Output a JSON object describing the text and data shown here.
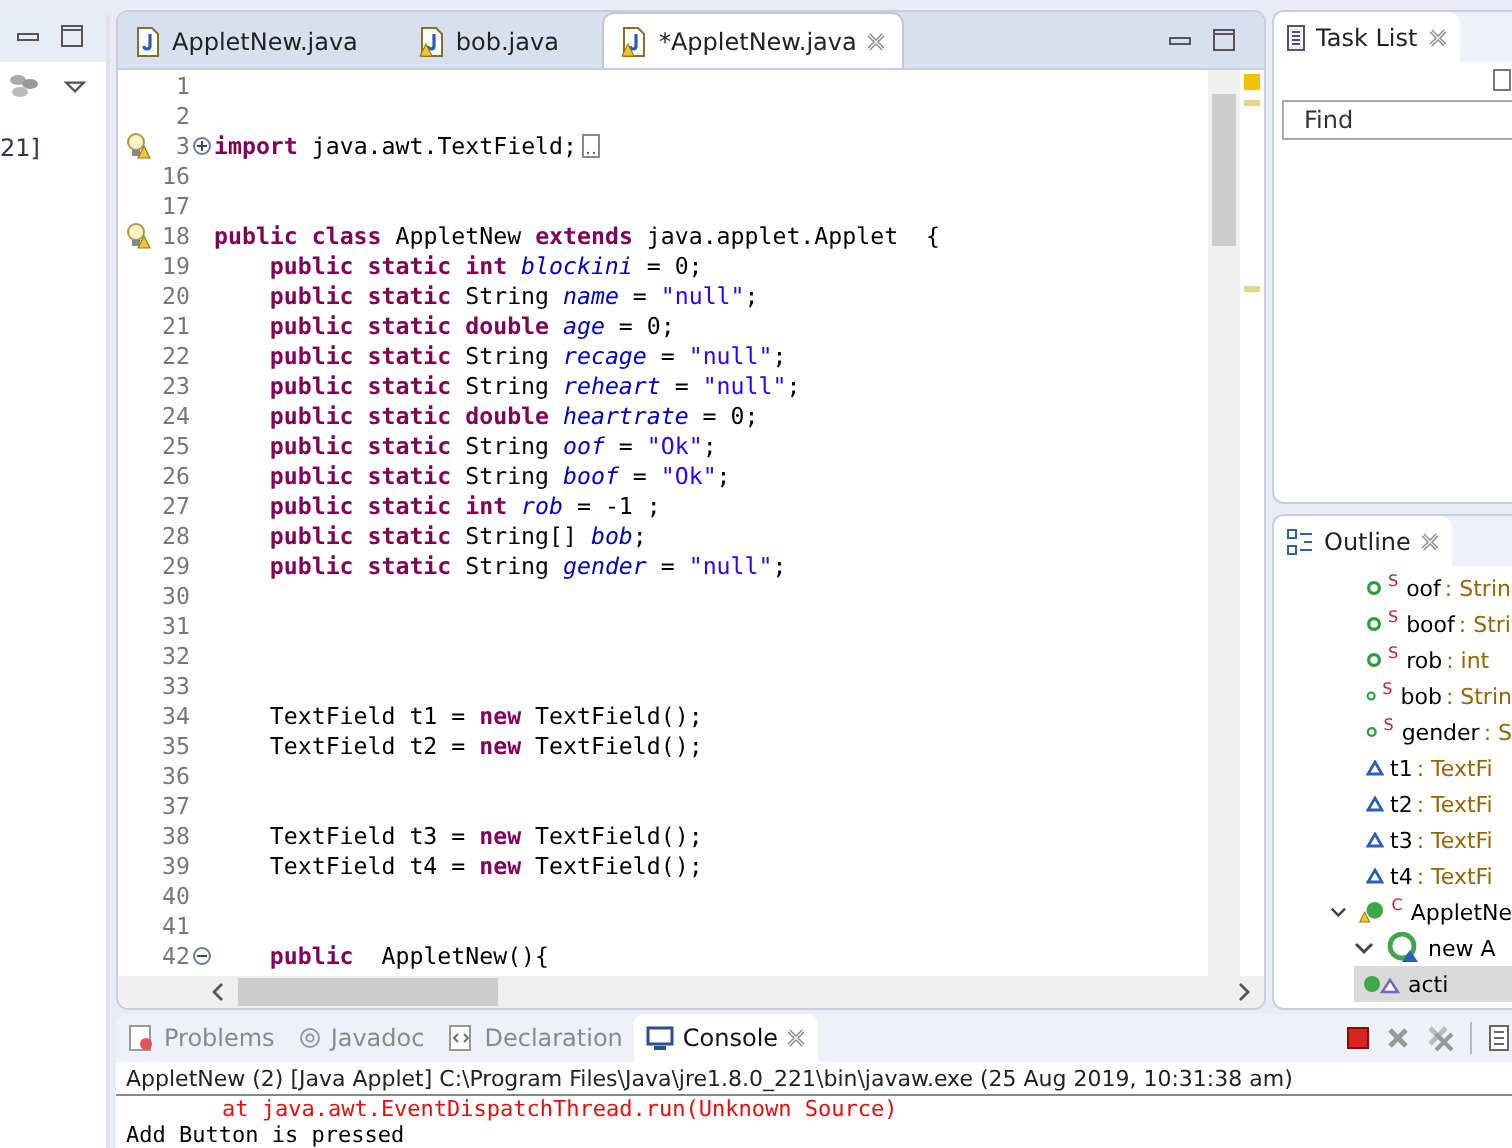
{
  "left_pane": {
    "fragment": "21]"
  },
  "editor": {
    "tabs": [
      {
        "label": "AppletNew.java",
        "selected": false,
        "warning": false,
        "closable": false
      },
      {
        "label": "bob.java",
        "selected": false,
        "warning": true,
        "closable": false
      },
      {
        "label": "*AppletNew.java",
        "selected": true,
        "warning": true,
        "closable": true
      }
    ],
    "lines": [
      {
        "number": "1"
      },
      {
        "number": "2"
      },
      {
        "number": "3",
        "warning": true,
        "collapsed": true,
        "segments": [
          {
            "kind": "kw",
            "text": "import "
          },
          {
            "kind": "plain",
            "text": "java.awt.TextField;"
          }
        ]
      },
      {
        "number": "16"
      },
      {
        "number": "17"
      },
      {
        "number": "18",
        "warning": true,
        "segments": [
          {
            "kind": "kw",
            "text": "public class "
          },
          {
            "kind": "plain",
            "text": "AppletNew "
          },
          {
            "kind": "kw",
            "text": "extends "
          },
          {
            "kind": "plain",
            "text": "java.applet.Applet  {"
          }
        ]
      },
      {
        "number": "19",
        "indent": true,
        "segments": [
          {
            "kind": "kw",
            "text": "public static int "
          },
          {
            "kind": "field",
            "text": "blockini"
          },
          {
            "kind": "plain",
            "text": " = 0;"
          }
        ]
      },
      {
        "number": "20",
        "indent": true,
        "segments": [
          {
            "kind": "kw",
            "text": "public static"
          },
          {
            "kind": "plain",
            "text": " String "
          },
          {
            "kind": "field",
            "text": "name"
          },
          {
            "kind": "plain",
            "text": " = "
          },
          {
            "kind": "str",
            "text": "\"null\""
          },
          {
            "kind": "plain",
            "text": ";"
          }
        ]
      },
      {
        "number": "21",
        "indent": true,
        "segments": [
          {
            "kind": "kw",
            "text": "public static double "
          },
          {
            "kind": "field",
            "text": "age"
          },
          {
            "kind": "plain",
            "text": " = 0;"
          }
        ]
      },
      {
        "number": "22",
        "indent": true,
        "segments": [
          {
            "kind": "kw",
            "text": "public static"
          },
          {
            "kind": "plain",
            "text": " String "
          },
          {
            "kind": "field",
            "text": "recage"
          },
          {
            "kind": "plain",
            "text": " = "
          },
          {
            "kind": "str",
            "text": "\"null\""
          },
          {
            "kind": "plain",
            "text": ";"
          }
        ]
      },
      {
        "number": "23",
        "indent": true,
        "segments": [
          {
            "kind": "kw",
            "text": "public static"
          },
          {
            "kind": "plain",
            "text": " String "
          },
          {
            "kind": "field",
            "text": "reheart"
          },
          {
            "kind": "plain",
            "text": " = "
          },
          {
            "kind": "str",
            "text": "\"null\""
          },
          {
            "kind": "plain",
            "text": ";"
          }
        ]
      },
      {
        "number": "24",
        "indent": true,
        "segments": [
          {
            "kind": "kw",
            "text": "public static double "
          },
          {
            "kind": "field",
            "text": "heartrate"
          },
          {
            "kind": "plain",
            "text": " = 0;"
          }
        ]
      },
      {
        "number": "25",
        "indent": true,
        "segments": [
          {
            "kind": "kw",
            "text": "public static"
          },
          {
            "kind": "plain",
            "text": " String "
          },
          {
            "kind": "field",
            "text": "oof"
          },
          {
            "kind": "plain",
            "text": " = "
          },
          {
            "kind": "str",
            "text": "\"Ok\""
          },
          {
            "kind": "plain",
            "text": ";"
          }
        ]
      },
      {
        "number": "26",
        "indent": true,
        "segments": [
          {
            "kind": "kw",
            "text": "public static"
          },
          {
            "kind": "plain",
            "text": " String "
          },
          {
            "kind": "field",
            "text": "boof"
          },
          {
            "kind": "plain",
            "text": " = "
          },
          {
            "kind": "str",
            "text": "\"Ok\""
          },
          {
            "kind": "plain",
            "text": ";"
          }
        ]
      },
      {
        "number": "27",
        "indent": true,
        "segments": [
          {
            "kind": "kw",
            "text": "public static int "
          },
          {
            "kind": "field",
            "text": "rob"
          },
          {
            "kind": "plain",
            "text": " = -1 ;"
          }
        ]
      },
      {
        "number": "28",
        "indent": true,
        "segments": [
          {
            "kind": "kw",
            "text": "public static"
          },
          {
            "kind": "plain",
            "text": " String[] "
          },
          {
            "kind": "field",
            "text": "bob"
          },
          {
            "kind": "plain",
            "text": ";"
          }
        ]
      },
      {
        "number": "29",
        "indent": true,
        "segments": [
          {
            "kind": "kw",
            "text": "public static"
          },
          {
            "kind": "plain",
            "text": " String "
          },
          {
            "kind": "field",
            "text": "gender"
          },
          {
            "kind": "plain",
            "text": " = "
          },
          {
            "kind": "str",
            "text": "\"null\""
          },
          {
            "kind": "plain",
            "text": ";"
          }
        ]
      },
      {
        "number": "30"
      },
      {
        "number": "31"
      },
      {
        "number": "32"
      },
      {
        "number": "33"
      },
      {
        "number": "34",
        "indent": true,
        "segments": [
          {
            "kind": "plain",
            "text": "TextField t1 = "
          },
          {
            "kind": "kw",
            "text": "new"
          },
          {
            "kind": "plain",
            "text": " TextField();"
          }
        ]
      },
      {
        "number": "35",
        "indent": true,
        "segments": [
          {
            "kind": "plain",
            "text": "TextField t2 = "
          },
          {
            "kind": "kw",
            "text": "new"
          },
          {
            "kind": "plain",
            "text": " TextField();"
          }
        ]
      },
      {
        "number": "36"
      },
      {
        "number": "37"
      },
      {
        "number": "38",
        "indent": true,
        "segments": [
          {
            "kind": "plain",
            "text": "TextField t3 = "
          },
          {
            "kind": "kw",
            "text": "new"
          },
          {
            "kind": "plain",
            "text": " TextField();"
          }
        ]
      },
      {
        "number": "39",
        "indent": true,
        "segments": [
          {
            "kind": "plain",
            "text": "TextField t4 = "
          },
          {
            "kind": "kw",
            "text": "new"
          },
          {
            "kind": "plain",
            "text": " TextField();"
          }
        ]
      },
      {
        "number": "40"
      },
      {
        "number": "41"
      },
      {
        "number": "42",
        "collapsed": false,
        "indent": true,
        "segments": [
          {
            "kind": "kw",
            "text": "public"
          },
          {
            "kind": "plain",
            "text": "  AppletNew(){"
          }
        ]
      }
    ]
  },
  "task_list": {
    "title": "Task List",
    "find": {
      "placeholder": "Find"
    }
  },
  "outline": {
    "title": "Outline",
    "items": [
      {
        "kind": "static_field",
        "modifier": "S",
        "name": "oof",
        "type": " : Strin",
        "selected": false
      },
      {
        "kind": "static_field",
        "modifier": "S",
        "name": "boof",
        "type": " : Stri",
        "selected": false
      },
      {
        "kind": "static_field",
        "modifier": "S",
        "name": "rob",
        "type": " : int",
        "selected": false
      },
      {
        "kind": "static_field",
        "modifier": "S",
        "name": "bob",
        "type": " : Strin",
        "selected": false
      },
      {
        "kind": "static_field",
        "modifier": "S",
        "name": "gender",
        "type": " : S",
        "selected": false
      },
      {
        "kind": "field",
        "name": "t1",
        "type": " : TextFi",
        "selected": false
      },
      {
        "kind": "field",
        "name": "t2",
        "type": " : TextFi",
        "selected": false
      },
      {
        "kind": "field",
        "name": "t3",
        "type": " : TextFi",
        "selected": false
      },
      {
        "kind": "field",
        "name": "t4",
        "type": " : TextFi",
        "selected": false
      },
      {
        "kind": "class",
        "modifier": "C",
        "name": "AppletNe",
        "selected": false,
        "expanded": true,
        "children": [
          {
            "kind": "anonymous",
            "name": "new A",
            "selected": false,
            "expanded": true,
            "children": [
              {
                "kind": "method",
                "name": "acti",
                "selected": true
              }
            ]
          }
        ]
      }
    ]
  },
  "console": {
    "tabs": [
      {
        "label": "Problems",
        "selected": false,
        "closable": false
      },
      {
        "label": "Javadoc",
        "selected": false,
        "closable": false
      },
      {
        "label": "Declaration",
        "selected": false,
        "closable": false
      },
      {
        "label": "Console",
        "selected": true,
        "closable": true
      }
    ],
    "header": "AppletNew (2) [Java Applet] C:\\Program Files\\Java\\jre1.8.0_221\\bin\\javaw.exe (25 Aug 2019, 10:31:38 am)",
    "lines": [
      {
        "kind": "error",
        "text": "at java.awt.EventDispatchThread.run(Unknown Source)"
      },
      {
        "kind": "output",
        "text": "Add Button is pressed"
      }
    ]
  }
}
